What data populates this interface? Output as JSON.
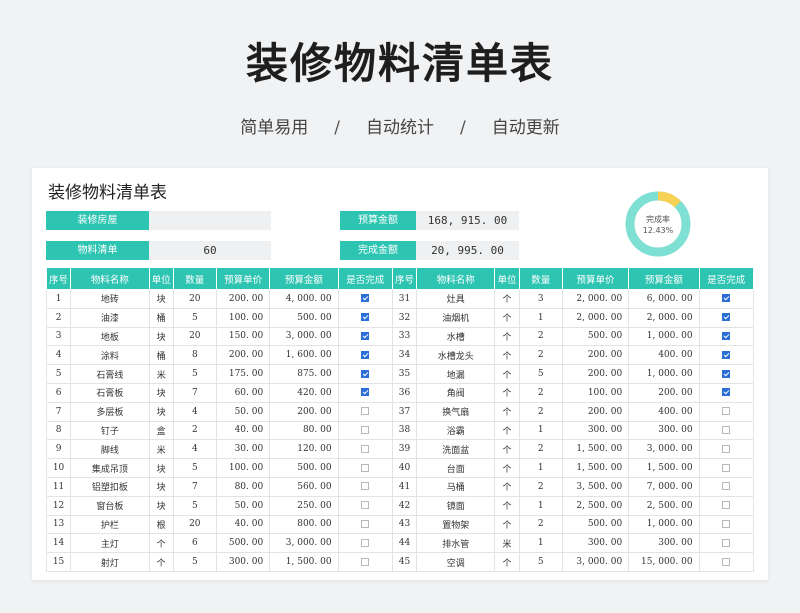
{
  "hero": {
    "title": "装修物料清单表",
    "subtitle_parts": [
      "简单易用",
      "自动统计",
      "自动更新"
    ],
    "separator": "/"
  },
  "sheet": {
    "title": "装修物料清单表",
    "house_label": "装修房屋",
    "house_value": "",
    "list_label": "物料清单",
    "list_value": "60",
    "budget_label": "预算金额",
    "budget_value": "168, 915. 00",
    "done_label": "完成金额",
    "done_value": "20, 995. 00",
    "completion_label": "完成率",
    "completion_value": "12.43%",
    "completion_fraction": 0.1243
  },
  "colors": {
    "accent": "#2ec4b2",
    "donut_track": "#7edfd3",
    "donut_fill": "#f7d154",
    "checkbox_on": "#2b6fd6"
  },
  "table": {
    "headers": [
      "序号",
      "物料名称",
      "单位",
      "数量",
      "预算单价",
      "预算金额",
      "是否完成",
      "序号",
      "物料名称",
      "单位",
      "数量",
      "预算单价",
      "预算金额",
      "是否完成"
    ],
    "left": [
      {
        "no": "1",
        "name": "地砖",
        "unit": "块",
        "qty": "20",
        "price": "200. 00",
        "amount": "4, 000. 00",
        "done": true
      },
      {
        "no": "2",
        "name": "油漆",
        "unit": "桶",
        "qty": "5",
        "price": "100. 00",
        "amount": "500. 00",
        "done": true
      },
      {
        "no": "3",
        "name": "地板",
        "unit": "块",
        "qty": "20",
        "price": "150. 00",
        "amount": "3, 000. 00",
        "done": true
      },
      {
        "no": "4",
        "name": "涂料",
        "unit": "桶",
        "qty": "8",
        "price": "200. 00",
        "amount": "1, 600. 00",
        "done": true
      },
      {
        "no": "5",
        "name": "石膏线",
        "unit": "米",
        "qty": "5",
        "price": "175. 00",
        "amount": "875. 00",
        "done": true
      },
      {
        "no": "6",
        "name": "石膏板",
        "unit": "块",
        "qty": "7",
        "price": "60. 00",
        "amount": "420. 00",
        "done": true
      },
      {
        "no": "7",
        "name": "多层板",
        "unit": "块",
        "qty": "4",
        "price": "50. 00",
        "amount": "200. 00",
        "done": false
      },
      {
        "no": "8",
        "name": "钉子",
        "unit": "盒",
        "qty": "2",
        "price": "40. 00",
        "amount": "80. 00",
        "done": false
      },
      {
        "no": "9",
        "name": "脚线",
        "unit": "米",
        "qty": "4",
        "price": "30. 00",
        "amount": "120. 00",
        "done": false
      },
      {
        "no": "10",
        "name": "集成吊顶",
        "unit": "块",
        "qty": "5",
        "price": "100. 00",
        "amount": "500. 00",
        "done": false
      },
      {
        "no": "11",
        "name": "铝塑扣板",
        "unit": "块",
        "qty": "7",
        "price": "80. 00",
        "amount": "560. 00",
        "done": false
      },
      {
        "no": "12",
        "name": "窗台板",
        "unit": "块",
        "qty": "5",
        "price": "50. 00",
        "amount": "250. 00",
        "done": false
      },
      {
        "no": "13",
        "name": "护栏",
        "unit": "根",
        "qty": "20",
        "price": "40. 00",
        "amount": "800. 00",
        "done": false
      },
      {
        "no": "14",
        "name": "主灯",
        "unit": "个",
        "qty": "6",
        "price": "500. 00",
        "amount": "3, 000. 00",
        "done": false
      },
      {
        "no": "15",
        "name": "射灯",
        "unit": "个",
        "qty": "5",
        "price": "300. 00",
        "amount": "1, 500. 00",
        "done": false
      }
    ],
    "right": [
      {
        "no": "31",
        "name": "灶具",
        "unit": "个",
        "qty": "3",
        "price": "2, 000. 00",
        "amount": "6, 000. 00",
        "done": true
      },
      {
        "no": "32",
        "name": "油烟机",
        "unit": "个",
        "qty": "1",
        "price": "2, 000. 00",
        "amount": "2, 000. 00",
        "done": true
      },
      {
        "no": "33",
        "name": "水槽",
        "unit": "个",
        "qty": "2",
        "price": "500. 00",
        "amount": "1, 000. 00",
        "done": true
      },
      {
        "no": "34",
        "name": "水槽龙头",
        "unit": "个",
        "qty": "2",
        "price": "200. 00",
        "amount": "400. 00",
        "done": true
      },
      {
        "no": "35",
        "name": "地漏",
        "unit": "个",
        "qty": "5",
        "price": "200. 00",
        "amount": "1, 000. 00",
        "done": true
      },
      {
        "no": "36",
        "name": "角阀",
        "unit": "个",
        "qty": "2",
        "price": "100. 00",
        "amount": "200. 00",
        "done": true
      },
      {
        "no": "37",
        "name": "换气扇",
        "unit": "个",
        "qty": "2",
        "price": "200. 00",
        "amount": "400. 00",
        "done": false
      },
      {
        "no": "38",
        "name": "浴霸",
        "unit": "个",
        "qty": "1",
        "price": "300. 00",
        "amount": "300. 00",
        "done": false
      },
      {
        "no": "39",
        "name": "洗面盆",
        "unit": "个",
        "qty": "2",
        "price": "1, 500. 00",
        "amount": "3, 000. 00",
        "done": false
      },
      {
        "no": "40",
        "name": "台面",
        "unit": "个",
        "qty": "1",
        "price": "1, 500. 00",
        "amount": "1, 500. 00",
        "done": false
      },
      {
        "no": "41",
        "name": "马桶",
        "unit": "个",
        "qty": "2",
        "price": "3, 500. 00",
        "amount": "7, 000. 00",
        "done": false
      },
      {
        "no": "42",
        "name": "镜面",
        "unit": "个",
        "qty": "1",
        "price": "2, 500. 00",
        "amount": "2, 500. 00",
        "done": false
      },
      {
        "no": "43",
        "name": "置物架",
        "unit": "个",
        "qty": "2",
        "price": "500. 00",
        "amount": "1, 000. 00",
        "done": false
      },
      {
        "no": "44",
        "name": "排水管",
        "unit": "米",
        "qty": "1",
        "price": "300. 00",
        "amount": "300. 00",
        "done": false
      },
      {
        "no": "45",
        "name": "空调",
        "unit": "个",
        "qty": "5",
        "price": "3, 000. 00",
        "amount": "15, 000. 00",
        "done": false
      }
    ]
  }
}
